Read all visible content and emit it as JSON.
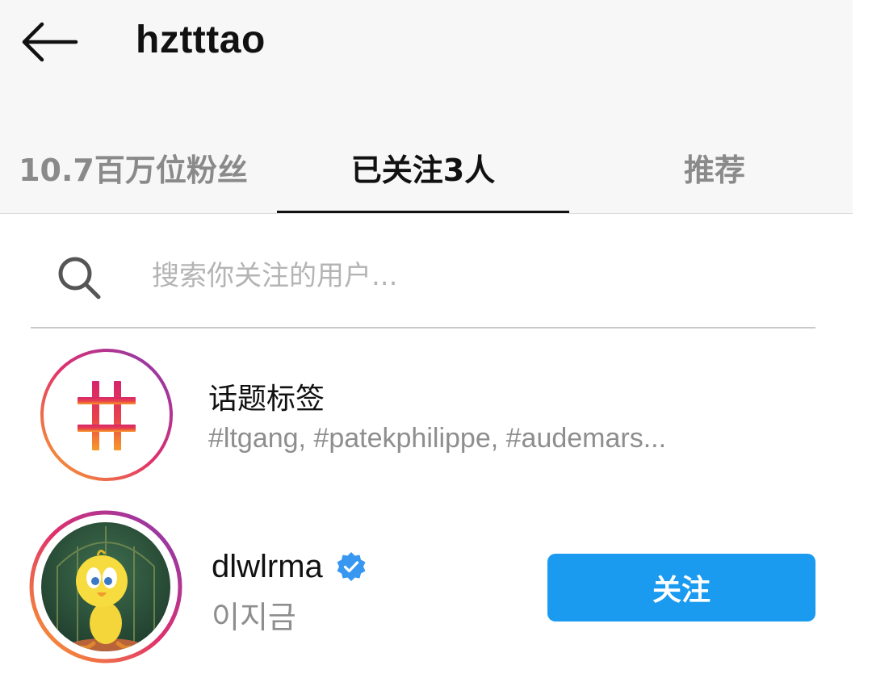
{
  "header": {
    "title": "hztttao"
  },
  "tabs": [
    {
      "label": "10.7百万位粉丝",
      "active": false
    },
    {
      "label": "已关注3人",
      "active": true
    },
    {
      "label": "推荐",
      "active": false
    }
  ],
  "search": {
    "placeholder": "搜索你关注的用户..."
  },
  "hashtags": {
    "title": "话题标签",
    "subtitle": "#ltgang, #patekphilippe, #audemars..."
  },
  "users": [
    {
      "username": "dlwlrma",
      "display_name": "이지금",
      "verified": true,
      "follow_label": "关注"
    }
  ],
  "colors": {
    "accent": "#1a9bf0",
    "verified": "#3897f0"
  },
  "icons": {
    "back": "arrow-left-icon",
    "search": "search-icon",
    "hashtag": "hashtag-icon",
    "verified": "verified-badge-icon"
  }
}
